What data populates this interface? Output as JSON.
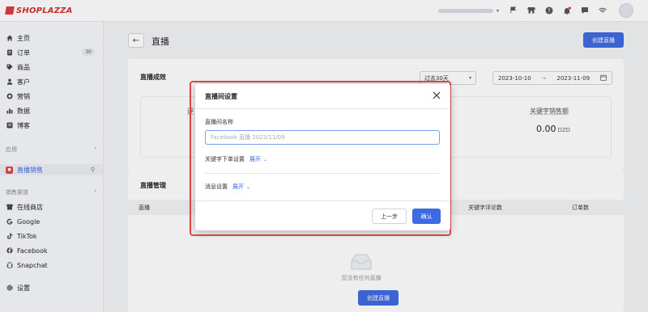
{
  "brand": {
    "logo_text": "SHOPLAZZA",
    "accent": "#3d6ae0",
    "logo_color": "#d62e2e"
  },
  "topbar": {
    "icons": [
      "flag-icon",
      "store-icon",
      "help-icon",
      "bell-icon",
      "chat-icon",
      "wifi-icon"
    ]
  },
  "sidebar": {
    "items": [
      {
        "label": "主页",
        "icon": "home-icon"
      },
      {
        "label": "订单",
        "icon": "order-icon",
        "badge": "30"
      },
      {
        "label": "商品",
        "icon": "tag-icon"
      },
      {
        "label": "客户",
        "icon": "user-icon"
      },
      {
        "label": "营销",
        "icon": "marketing-icon"
      },
      {
        "label": "数据",
        "icon": "chart-icon"
      },
      {
        "label": "博客",
        "icon": "blog-icon"
      }
    ],
    "apps_label": "应用",
    "live_item": {
      "label": "直播销售"
    },
    "channels_label": "销售渠道",
    "channels": [
      {
        "label": "在线商店",
        "icon": "store-icon"
      },
      {
        "label": "Google",
        "icon": "google-icon"
      },
      {
        "label": "TikTok",
        "icon": "tiktok-icon"
      },
      {
        "label": "Facebook",
        "icon": "facebook-icon"
      },
      {
        "label": "Snapchat",
        "icon": "snapchat-icon"
      }
    ],
    "settings": {
      "label": "设置",
      "icon": "gear-icon"
    }
  },
  "main": {
    "title": "直播",
    "create_button": "创建直播",
    "performance": {
      "title": "直播成效",
      "period": "过去30天",
      "date_start": "2023-10-10",
      "date_end": "2023-11-09",
      "arrow": "→",
      "metric_partial": "评",
      "metric_label": "关键字销售额",
      "metric_value": "0.00",
      "metric_unit": "DZD"
    },
    "management": {
      "title": "直播管理",
      "columns": [
        "直播",
        "关键字评论数",
        "订单数"
      ],
      "empty_text": "您没有任何直播",
      "create_button": "创建直播"
    }
  },
  "modal": {
    "title": "直播间设置",
    "name_label": "直播间名称",
    "name_placeholder": "Facebook 直播 2023/11/09",
    "keyword_order_label": "关键字下单设置",
    "message_label": "消息设置",
    "expand_label": "展开",
    "prev_button": "上一步",
    "confirm_button": "确认"
  }
}
